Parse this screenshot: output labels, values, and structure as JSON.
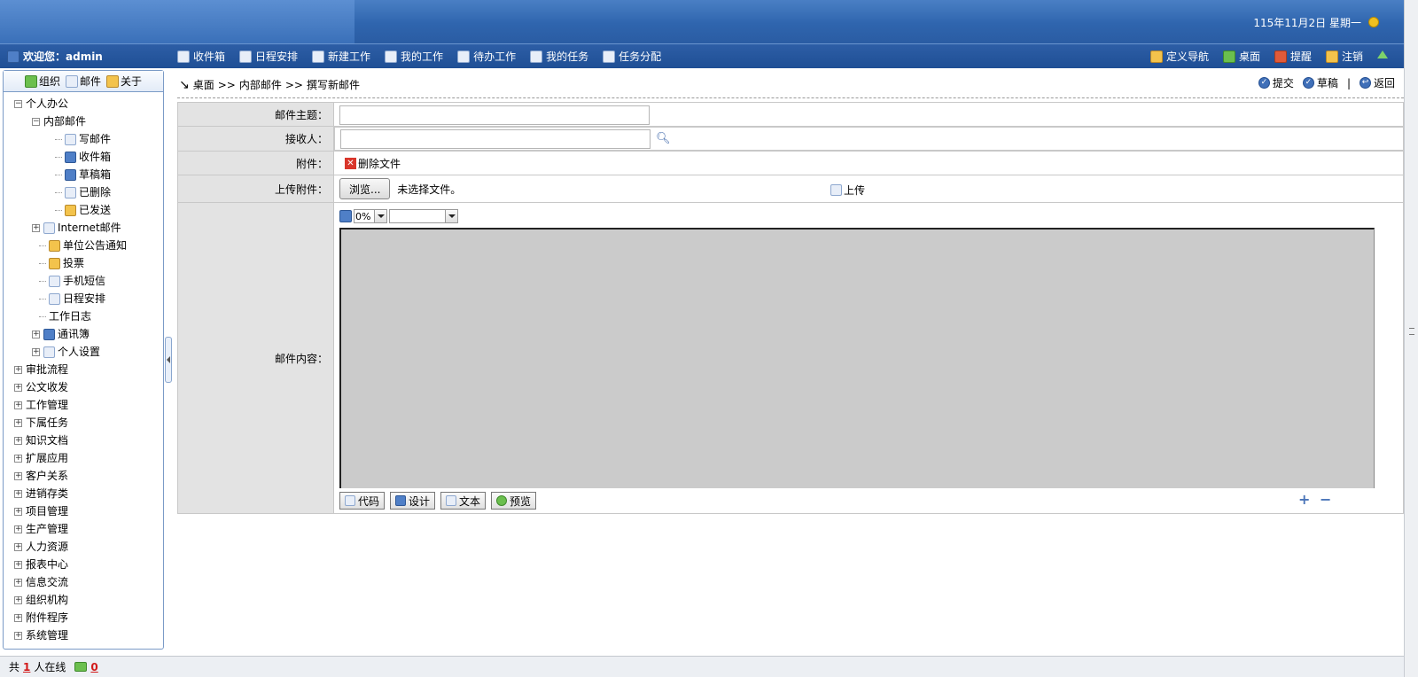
{
  "header": {
    "date": "115年11月2日 星期一"
  },
  "nav": {
    "welcome": "欢迎您：admin",
    "left_items": [
      {
        "label": "收件箱",
        "icon": "inbox-icon"
      },
      {
        "label": "日程安排",
        "icon": "calendar-icon"
      },
      {
        "label": "新建工作",
        "icon": "new-work-icon"
      },
      {
        "label": "我的工作",
        "icon": "my-work-icon"
      },
      {
        "label": "待办工作",
        "icon": "todo-icon"
      },
      {
        "label": "我的任务",
        "icon": "task-icon"
      },
      {
        "label": "任务分配",
        "icon": "assign-icon"
      }
    ],
    "right_items": [
      {
        "label": "定义导航",
        "icon": "define-nav-icon"
      },
      {
        "label": "桌面",
        "icon": "desktop-icon"
      },
      {
        "label": "提醒",
        "icon": "reminder-icon"
      },
      {
        "label": "注销",
        "icon": "logout-icon"
      }
    ]
  },
  "left_tabs": [
    "组织",
    "邮件",
    "关于"
  ],
  "tree": {
    "personal_office": "个人办公",
    "internal_mail": "内部邮件",
    "mail_children": [
      "写邮件",
      "收件箱",
      "草稿箱",
      "已删除",
      "已发送"
    ],
    "personal_children": [
      "Internet邮件",
      "单位公告通知",
      "投票",
      "手机短信",
      "日程安排",
      "工作日志",
      "通讯簿",
      "个人设置"
    ],
    "top_level": [
      "审批流程",
      "公文收发",
      "工作管理",
      "下属任务",
      "知识文档",
      "扩展应用",
      "客户关系",
      "进销存类",
      "项目管理",
      "生产管理",
      "人力资源",
      "报表中心",
      "信息交流",
      "组织机构",
      "附件程序",
      "系统管理"
    ]
  },
  "breadcrumb": {
    "items": [
      "桌面",
      ">>",
      "内部邮件",
      ">>",
      "撰写新邮件"
    ]
  },
  "actions": {
    "submit": "提交",
    "draft": "草稿",
    "sep": "|",
    "back": "返回"
  },
  "form": {
    "subject_label": "邮件主题：",
    "subject_value": "",
    "recipient_label": "接收人：",
    "recipient_value": "",
    "attachment_label": "附件：",
    "delete_file": "删除文件",
    "upload_label": "上传附件：",
    "browse": "浏览...",
    "no_file": "未选择文件。",
    "upload": "上传",
    "content_label": "邮件内容："
  },
  "editor": {
    "zoom": "0%",
    "modes": [
      "代码",
      "设计",
      "文本",
      "预览"
    ]
  },
  "footer": {
    "prefix": "共",
    "online_count": "1",
    "suffix": "人在线",
    "mail_count": "0"
  }
}
